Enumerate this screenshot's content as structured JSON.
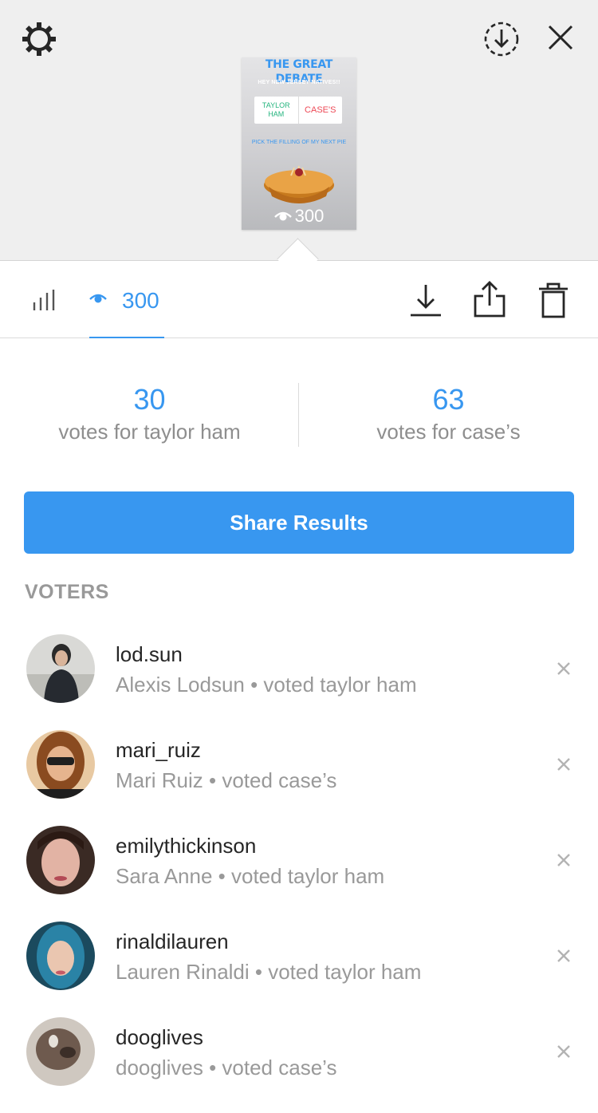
{
  "header": {
    "icons": [
      "gear-icon",
      "download-circle-icon",
      "close-icon"
    ]
  },
  "story": {
    "title": "THE GREAT DEBATE",
    "subtitle": "HEY NEW JERSEY NATIVES!!",
    "poll_option_a": "TAYLOR HAM",
    "poll_option_b": "CASE'S",
    "caption": "PICK THE FILLING OF MY NEXT PIE",
    "views": "300"
  },
  "tabs": {
    "viewers_count": "300",
    "icons": [
      "bar-chart-icon",
      "eye-icon",
      "download-icon",
      "share-icon",
      "trash-icon"
    ]
  },
  "results": {
    "left_count": "30",
    "left_label": "votes for taylor ham",
    "right_count": "63",
    "right_label": "votes for case’s"
  },
  "share_button": "Share Results",
  "voters_header": "VOTERS",
  "voters": [
    {
      "username": "lod.sun",
      "detail": "Alexis Lodsun • voted taylor ham"
    },
    {
      "username": "mari_ruiz",
      "detail": "Mari Ruiz • voted case’s"
    },
    {
      "username": "emilythickinson",
      "detail": "Sara Anne • voted taylor ham"
    },
    {
      "username": "rinaldilauren",
      "detail": "Lauren Rinaldi • voted taylor ham"
    },
    {
      "username": "dooglives",
      "detail": "dooglives • voted case’s"
    }
  ],
  "colors": {
    "accent": "#3897f0",
    "muted_text": "#999999",
    "primary_text": "#262626",
    "top_background": "#efefef"
  }
}
